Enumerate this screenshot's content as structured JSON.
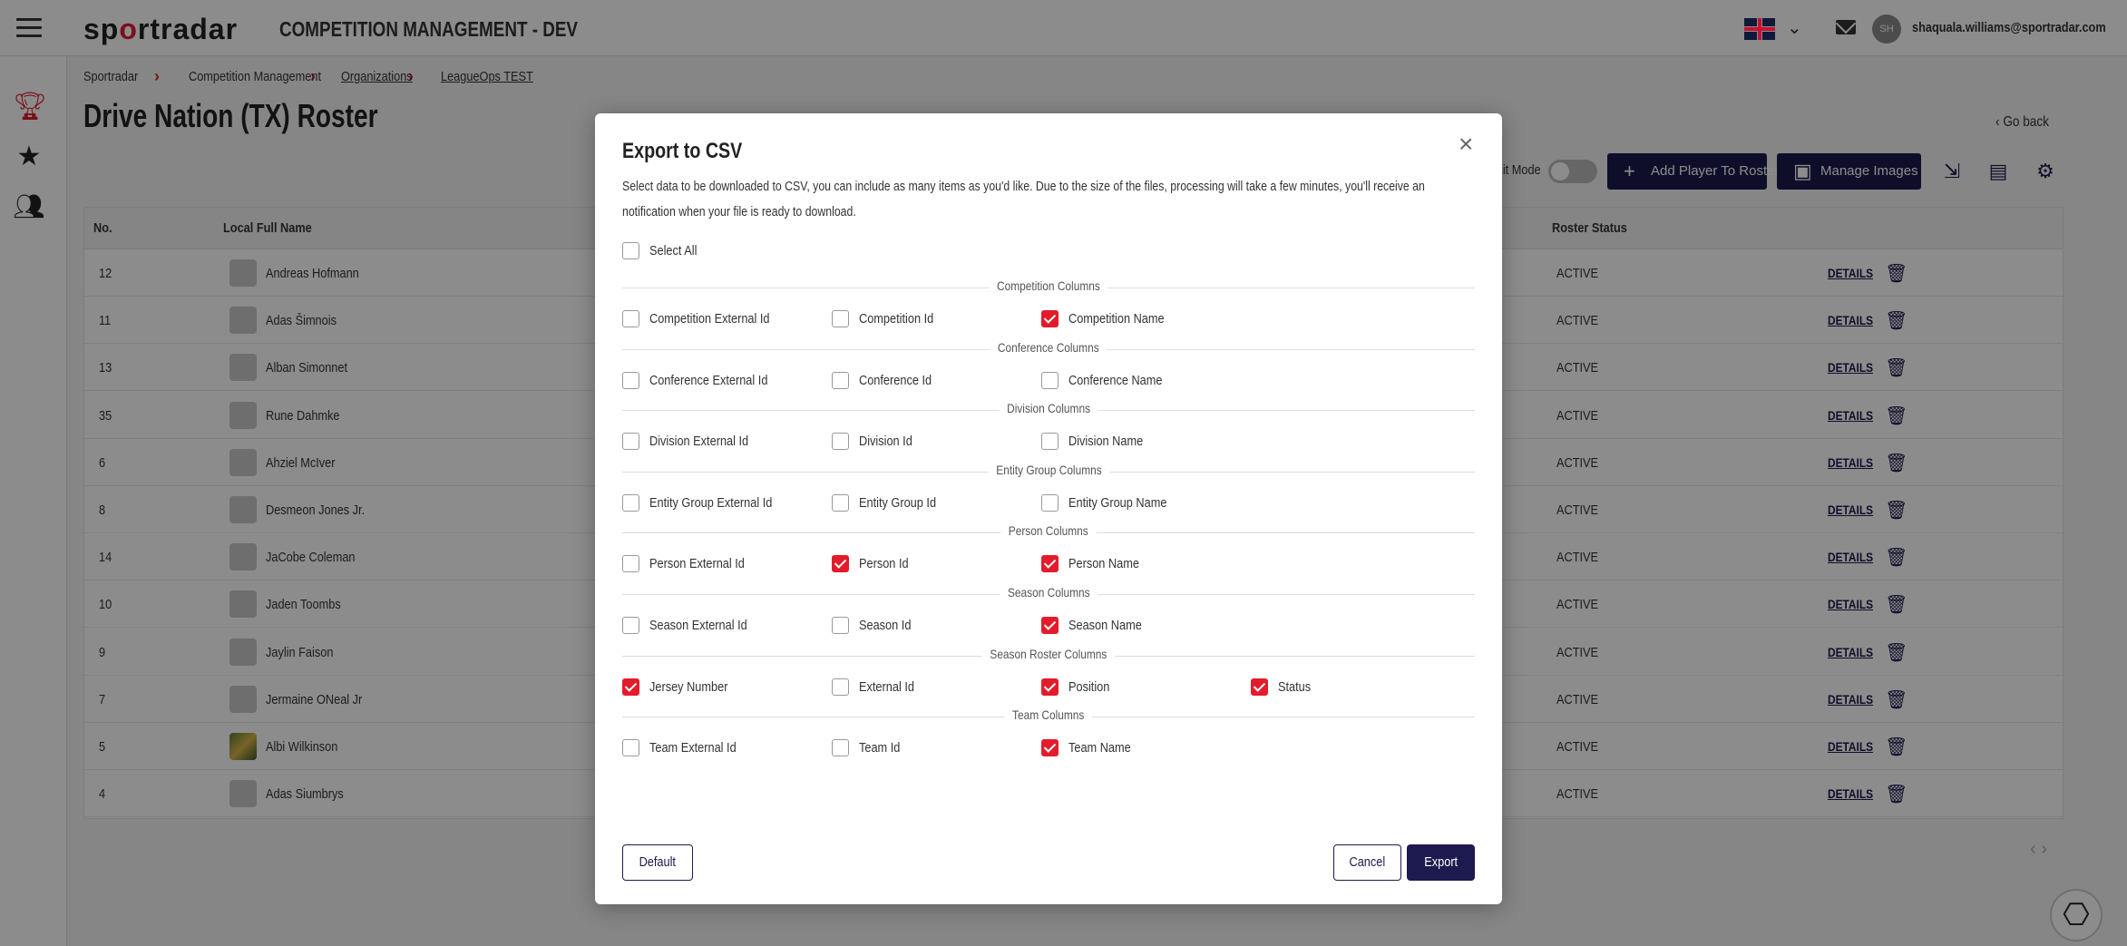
{
  "header": {
    "logo": {
      "pre": "sp",
      "o": "o",
      "post": "rtradar"
    },
    "app_title": "COMPETITION MANAGEMENT - DEV",
    "user_initials": "SH",
    "user_email": "shaquala.williams@sportradar.com"
  },
  "breadcrumb": [
    "Sportradar",
    "Competition Management",
    "Organizations",
    "LeagueOps TEST"
  ],
  "page": {
    "title": "Drive Nation (TX) Roster",
    "go_back": "Go back",
    "edit_mode": "lit Mode",
    "add_player": "Add Player To Roster",
    "manage_images": "Manage Images"
  },
  "table": {
    "headers": {
      "no": "No.",
      "name": "Local Full Name",
      "status": "Roster Status"
    },
    "details_label": "DETAILS",
    "rows": [
      {
        "no": "12",
        "name": "Andreas Hofmann",
        "status": "ACTIVE",
        "photo": false
      },
      {
        "no": "11",
        "name": "Adas Šimnois",
        "status": "ACTIVE",
        "photo": false
      },
      {
        "no": "13",
        "name": "Alban Simonnet",
        "status": "ACTIVE",
        "photo": false
      },
      {
        "no": "35",
        "name": "Rune Dahmke",
        "status": "ACTIVE",
        "photo": false
      },
      {
        "no": "6",
        "name": "Ahziel McIver",
        "status": "ACTIVE",
        "photo": false
      },
      {
        "no": "8",
        "name": "Desmeon Jones Jr.",
        "status": "ACTIVE",
        "photo": false
      },
      {
        "no": "14",
        "name": "JaCobe Coleman",
        "status": "ACTIVE",
        "photo": false
      },
      {
        "no": "10",
        "name": "Jaden Toombs",
        "status": "ACTIVE",
        "photo": false
      },
      {
        "no": "9",
        "name": "Jaylin Faison",
        "status": "ACTIVE",
        "photo": false
      },
      {
        "no": "7",
        "name": "Jermaine ONeal Jr",
        "status": "ACTIVE",
        "photo": false
      },
      {
        "no": "5",
        "name": "Albi Wilkinson",
        "status": "ACTIVE",
        "photo": true
      },
      {
        "no": "4",
        "name": "Adas Siumbrys",
        "status": "ACTIVE",
        "photo": false
      }
    ]
  },
  "modal": {
    "title": "Export to CSV",
    "description": "Select data to be downloaded to CSV, you can include as many items as you'd like. Due to the size of the files, processing will take a few minutes, you'll receive an notification when your file is ready to download.",
    "select_all": "Select All",
    "sections": [
      {
        "title": "Competition Columns",
        "items": [
          {
            "label": "Competition External Id",
            "checked": false
          },
          {
            "label": "Competition Id",
            "checked": false
          },
          {
            "label": "Competition Name",
            "checked": true
          }
        ]
      },
      {
        "title": "Conference Columns",
        "items": [
          {
            "label": "Conference External Id",
            "checked": false
          },
          {
            "label": "Conference Id",
            "checked": false
          },
          {
            "label": "Conference Name",
            "checked": false
          }
        ]
      },
      {
        "title": "Division Columns",
        "items": [
          {
            "label": "Division External Id",
            "checked": false
          },
          {
            "label": "Division Id",
            "checked": false
          },
          {
            "label": "Division Name",
            "checked": false
          }
        ]
      },
      {
        "title": "Entity Group Columns",
        "items": [
          {
            "label": "Entity Group External Id",
            "checked": false
          },
          {
            "label": "Entity Group Id",
            "checked": false
          },
          {
            "label": "Entity Group Name",
            "checked": false
          }
        ]
      },
      {
        "title": "Person Columns",
        "items": [
          {
            "label": "Person External Id",
            "checked": false
          },
          {
            "label": "Person Id",
            "checked": true
          },
          {
            "label": "Person Name",
            "checked": true
          }
        ]
      },
      {
        "title": "Season Columns",
        "items": [
          {
            "label": "Season External Id",
            "checked": false
          },
          {
            "label": "Season Id",
            "checked": false
          },
          {
            "label": "Season Name",
            "checked": true
          }
        ]
      },
      {
        "title": "Season Roster Columns",
        "items": [
          {
            "label": "Jersey Number",
            "checked": true
          },
          {
            "label": "External Id",
            "checked": false
          },
          {
            "label": "Position",
            "checked": true
          },
          {
            "label": "Status",
            "checked": true
          }
        ]
      },
      {
        "title": "Team Columns",
        "items": [
          {
            "label": "Team External Id",
            "checked": false
          },
          {
            "label": "Team Id",
            "checked": false
          },
          {
            "label": "Team Name",
            "checked": true
          }
        ]
      }
    ],
    "buttons": {
      "default": "Default",
      "cancel": "Cancel",
      "export": "Export"
    }
  },
  "colors": {
    "brand_red": "#e21c2b",
    "navy": "#1c1a4e"
  },
  "icons": [
    "hamburger-icon",
    "trophy-icon",
    "star-icon",
    "people-icon",
    "mail-icon",
    "chevron-down-icon",
    "chevron-left-icon",
    "plus-icon",
    "image-icon",
    "import-icon",
    "document-icon",
    "gear-icon",
    "trash-icon",
    "close-icon",
    "chat-icon"
  ]
}
